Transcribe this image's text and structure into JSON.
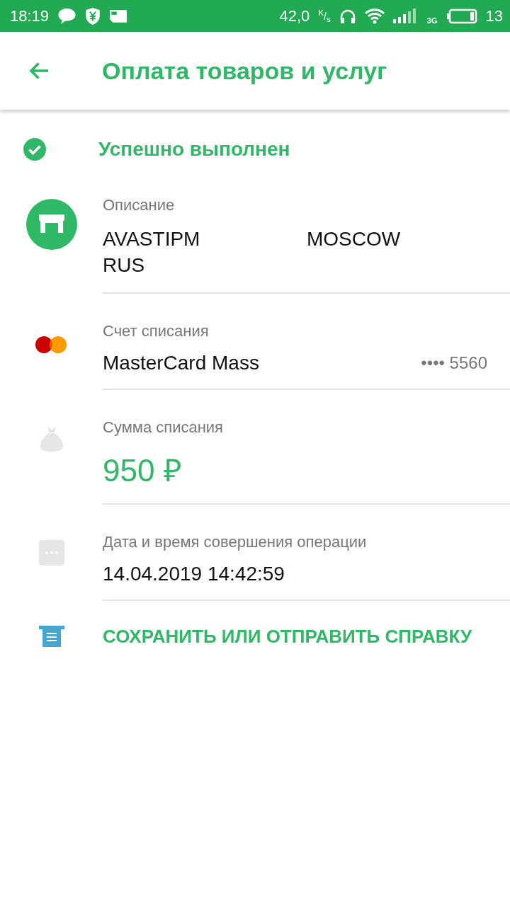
{
  "status_bar": {
    "time": "18:19",
    "speed": "42,0",
    "speed_unit": "$^{K}$/$_{s}$",
    "network": "3G",
    "battery": "13"
  },
  "header": {
    "title": "Оплата товаров и услуг"
  },
  "status": {
    "text": "Успешно выполнен"
  },
  "fields": [
    {
      "kind": "merchant",
      "label": "Описание",
      "value_parts": [
        "AVASTIPM",
        "MOSCOW",
        "RUS"
      ]
    },
    {
      "kind": "card",
      "label": "Счет списания",
      "value": "MasterCard Mass",
      "number": "•••• 5560"
    },
    {
      "kind": "amount",
      "label": "Сумма списания",
      "value": "950 ₽"
    },
    {
      "kind": "date",
      "label": "Дата и время совершения операции",
      "value": "14.04.2019 14:42:59"
    }
  ],
  "action": {
    "label": "СОХРАНИТЬ ИЛИ ОТПРАВИТЬ СПРАВКУ"
  }
}
